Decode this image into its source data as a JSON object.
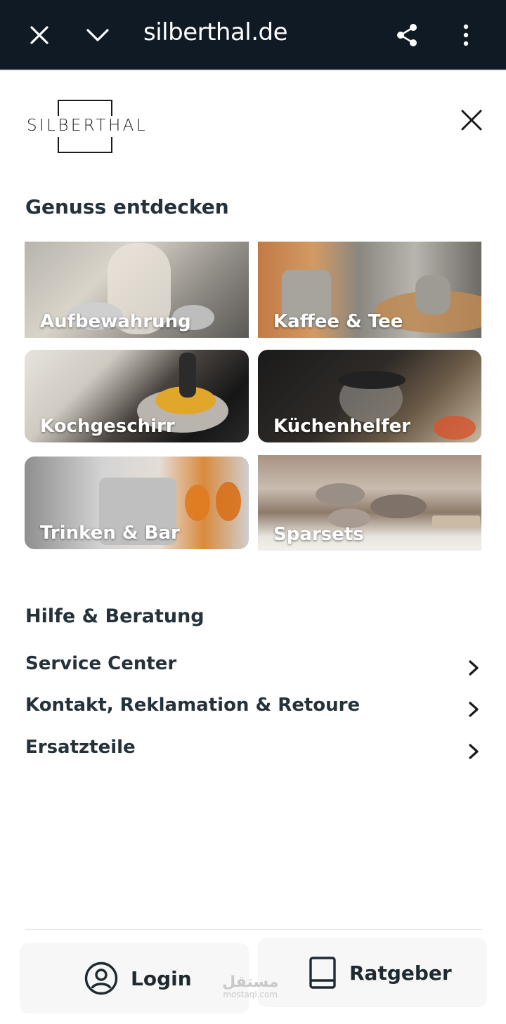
{
  "browser": {
    "url": "silberthal.de"
  },
  "header": {
    "logo_text": "SILBERTHAL"
  },
  "discover": {
    "title": "Genuss entdecken",
    "categories": [
      {
        "label": "Aufbewahrung"
      },
      {
        "label": "Kaffee & Tee"
      },
      {
        "label": "Kochgeschirr"
      },
      {
        "label": "Küchenhelfer"
      },
      {
        "label": "Trinken & Bar"
      },
      {
        "label": "Sparsets"
      }
    ]
  },
  "help": {
    "title": "Hilfe & Beratung",
    "items": [
      {
        "label": "Service Center"
      },
      {
        "label": "Kontakt, Reklamation & Retoure"
      },
      {
        "label": "Ersatzteile"
      }
    ]
  },
  "bottom": {
    "login_label": "Login",
    "ratgeber_label": "Ratgeber"
  },
  "watermark": {
    "arabic": "مستقل",
    "latin": "mostaql.com"
  }
}
